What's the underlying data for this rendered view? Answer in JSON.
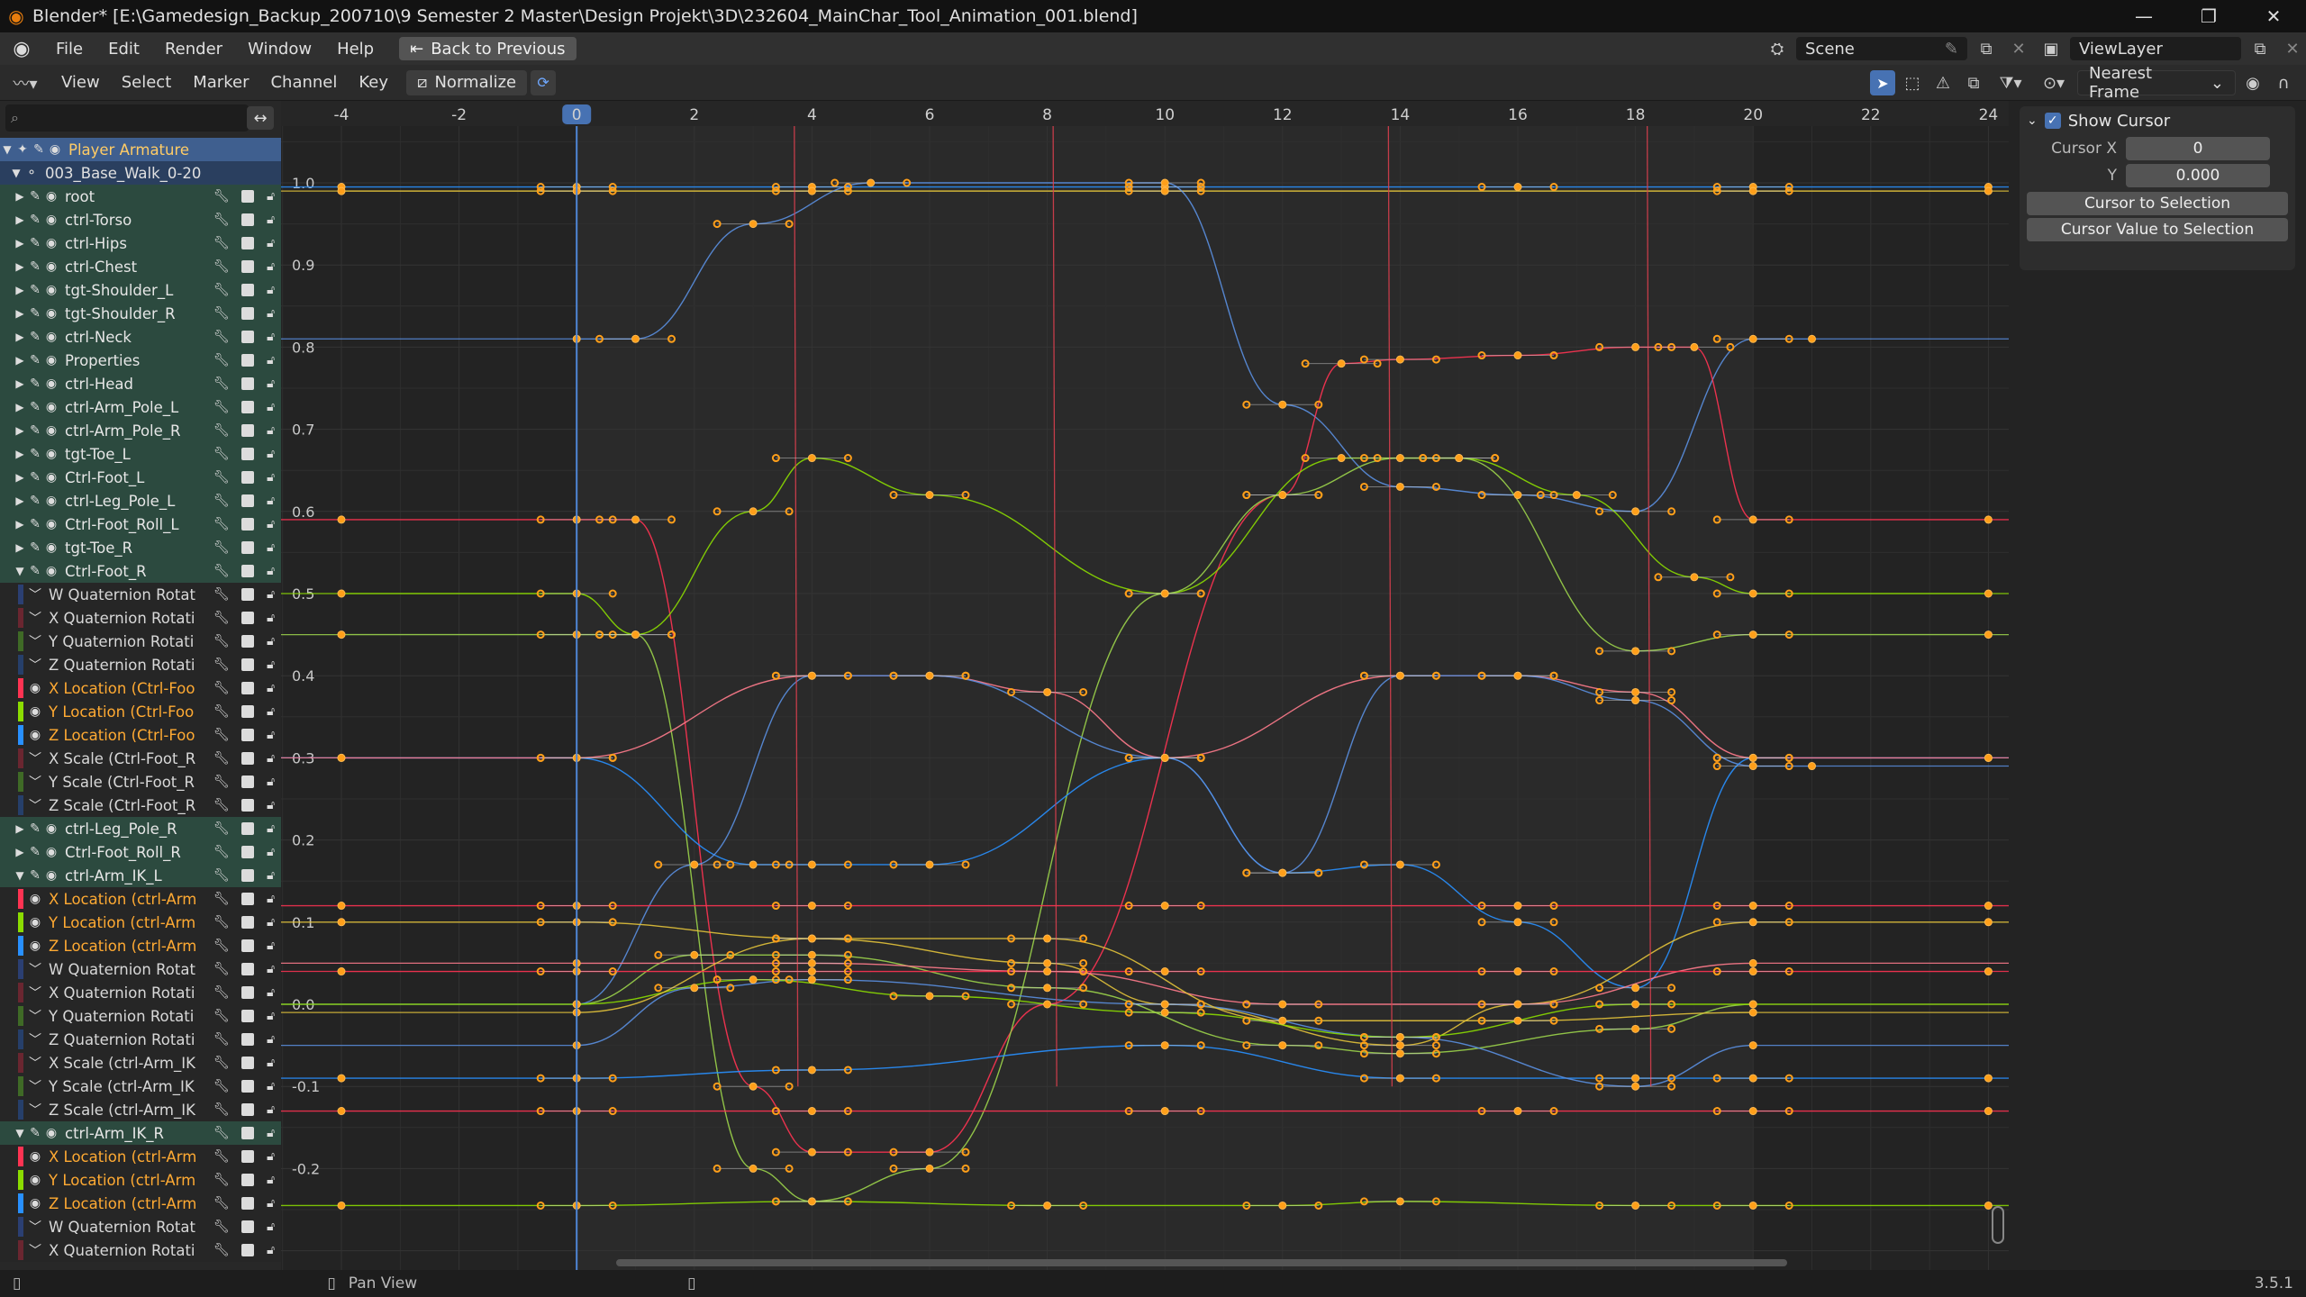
{
  "window": {
    "title": "Blender* [E:\\Gamedesign_Backup_200710\\9 Semester 2 Master\\Design Projekt\\3D\\232604_MainChar_Tool_Animation_001.blend]"
  },
  "menubar": {
    "items": [
      "File",
      "Edit",
      "Render",
      "Window",
      "Help"
    ],
    "back_button": "Back to Previous",
    "scene": "Scene",
    "view_layer": "ViewLayer"
  },
  "editor_header": {
    "menus": [
      "View",
      "Select",
      "Marker",
      "Channel",
      "Key"
    ],
    "normalize_label": "Normalize",
    "snap_mode": "Nearest Frame"
  },
  "channels": [
    {
      "kind": "object",
      "name": "Player Armature"
    },
    {
      "kind": "action",
      "name": "003_Base_Walk_0-20"
    },
    {
      "kind": "group",
      "name": "root"
    },
    {
      "kind": "group",
      "name": "ctrl-Torso"
    },
    {
      "kind": "group",
      "name": "ctrl-Hips"
    },
    {
      "kind": "group",
      "name": "ctrl-Chest"
    },
    {
      "kind": "group",
      "name": "tgt-Shoulder_L"
    },
    {
      "kind": "group",
      "name": "tgt-Shoulder_R"
    },
    {
      "kind": "group",
      "name": "ctrl-Neck"
    },
    {
      "kind": "group",
      "name": "Properties"
    },
    {
      "kind": "group",
      "name": "ctrl-Head"
    },
    {
      "kind": "group",
      "name": "ctrl-Arm_Pole_L"
    },
    {
      "kind": "group",
      "name": "ctrl-Arm_Pole_R"
    },
    {
      "kind": "group",
      "name": "tgt-Toe_L"
    },
    {
      "kind": "group",
      "name": "Ctrl-Foot_L"
    },
    {
      "kind": "group",
      "name": "ctrl-Leg_Pole_L"
    },
    {
      "kind": "group",
      "name": "Ctrl-Foot_Roll_L"
    },
    {
      "kind": "group",
      "name": "tgt-Toe_R"
    },
    {
      "kind": "group",
      "name": "Ctrl-Foot_R",
      "expanded": true
    },
    {
      "kind": "fcurve",
      "name": "W Quaternion Rotat",
      "color": "#2b3f72"
    },
    {
      "kind": "fcurve",
      "name": "X Quaternion Rotati",
      "color": "#6a2630"
    },
    {
      "kind": "fcurve",
      "name": "Y Quaternion Rotati",
      "color": "#3f6a26"
    },
    {
      "kind": "fcurve",
      "name": "Z Quaternion Rotati",
      "color": "#263f6a"
    },
    {
      "kind": "fcurve",
      "name": "X Location (Ctrl-Foo",
      "color": "#ff3352",
      "selected": true
    },
    {
      "kind": "fcurve",
      "name": "Y Location (Ctrl-Foo",
      "color": "#8bdc00",
      "selected": true
    },
    {
      "kind": "fcurve",
      "name": "Z Location (Ctrl-Foo",
      "color": "#2890ff",
      "selected": true
    },
    {
      "kind": "fcurve",
      "name": "X Scale (Ctrl-Foot_R",
      "color": "#6a2630"
    },
    {
      "kind": "fcurve",
      "name": "Y Scale (Ctrl-Foot_R",
      "color": "#3f6a26"
    },
    {
      "kind": "fcurve",
      "name": "Z Scale (Ctrl-Foot_R",
      "color": "#263f6a"
    },
    {
      "kind": "group",
      "name": "ctrl-Leg_Pole_R"
    },
    {
      "kind": "group",
      "name": "Ctrl-Foot_Roll_R"
    },
    {
      "kind": "group",
      "name": "ctrl-Arm_IK_L",
      "expanded": true
    },
    {
      "kind": "fcurve",
      "name": "X Location (ctrl-Arm",
      "color": "#ff3352",
      "selected": true
    },
    {
      "kind": "fcurve",
      "name": "Y Location (ctrl-Arm",
      "color": "#8bdc00",
      "selected": true
    },
    {
      "kind": "fcurve",
      "name": "Z Location (ctrl-Arm",
      "color": "#2890ff",
      "selected": true
    },
    {
      "kind": "fcurve",
      "name": "W Quaternion Rotat",
      "color": "#2b3f72"
    },
    {
      "kind": "fcurve",
      "name": "X Quaternion Rotati",
      "color": "#6a2630"
    },
    {
      "kind": "fcurve",
      "name": "Y Quaternion Rotati",
      "color": "#3f6a26"
    },
    {
      "kind": "fcurve",
      "name": "Z Quaternion Rotati",
      "color": "#263f6a"
    },
    {
      "kind": "fcurve",
      "name": "X Scale (ctrl-Arm_IK",
      "color": "#6a2630"
    },
    {
      "kind": "fcurve",
      "name": "Y Scale (ctrl-Arm_IK",
      "color": "#3f6a26"
    },
    {
      "kind": "fcurve",
      "name": "Z Scale (ctrl-Arm_IK",
      "color": "#263f6a"
    },
    {
      "kind": "group",
      "name": "ctrl-Arm_IK_R",
      "expanded": true
    },
    {
      "kind": "fcurve",
      "name": "X Location (ctrl-Arm",
      "color": "#ff3352",
      "selected": true
    },
    {
      "kind": "fcurve",
      "name": "Y Location (ctrl-Arm",
      "color": "#8bdc00",
      "selected": true
    },
    {
      "kind": "fcurve",
      "name": "Z Location (ctrl-Arm",
      "color": "#2890ff",
      "selected": true
    },
    {
      "kind": "fcurve",
      "name": "W Quaternion Rotat",
      "color": "#2b3f72"
    },
    {
      "kind": "fcurve",
      "name": "X Quaternion Rotati",
      "color": "#6a2630"
    }
  ],
  "graph": {
    "frame_ticks": [
      "-4",
      "-2",
      "0",
      "2",
      "4",
      "6",
      "8",
      "10",
      "12",
      "14",
      "16",
      "18",
      "20",
      "22",
      "24"
    ],
    "current_frame": "0",
    "value_ticks": [
      "1.0",
      "0.9",
      "0.8",
      "0.7",
      "0.6",
      "0.5",
      "0.4",
      "0.3",
      "0.2",
      "0.1",
      "0.0",
      "-0.1",
      "-0.2"
    ],
    "frame_range": [
      0,
      20
    ]
  },
  "sidebar": {
    "show_cursor_label": "Show Cursor",
    "cursor_x_label": "Cursor X",
    "cursor_x_value": "0",
    "cursor_y_label": "Y",
    "cursor_y_value": "0.000",
    "cursor_to_selection": "Cursor to Selection",
    "cursor_value_to_selection": "Cursor Value to Selection"
  },
  "statusbar": {
    "hint": "Pan View",
    "version": "3.5.1"
  },
  "colors": {
    "x_channel": "#ff3352",
    "y_channel": "#8bdc00",
    "z_channel": "#2890ff",
    "keyframe": "#ff9f1a",
    "accent": "#4772b3"
  }
}
